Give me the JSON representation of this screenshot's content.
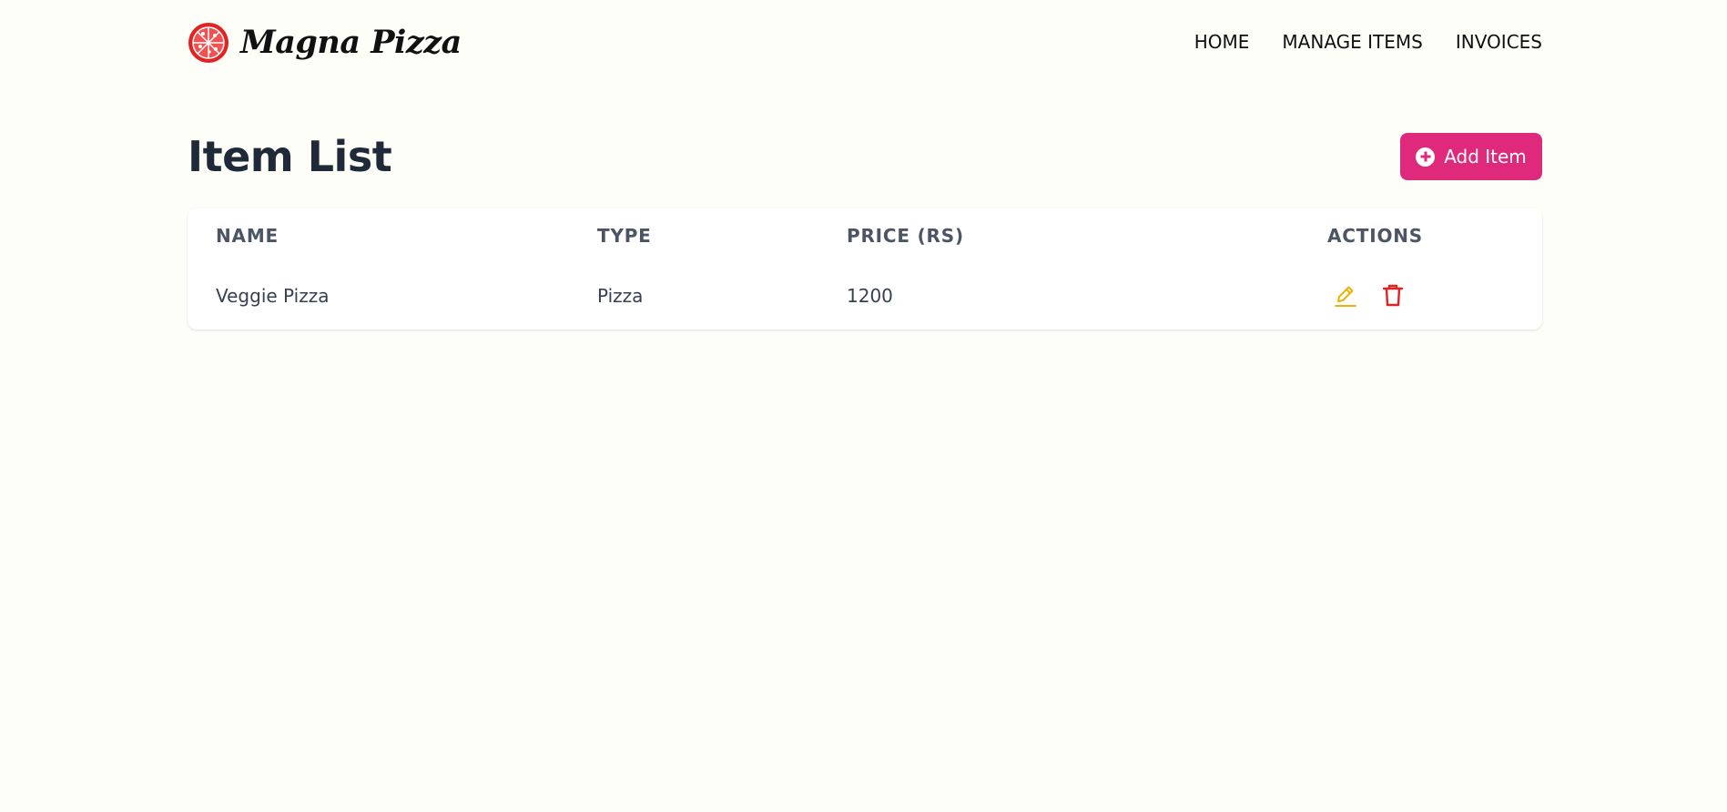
{
  "brand": {
    "name": "Magna Pizza",
    "logo_icon": "pizza-icon",
    "color": "#e02424"
  },
  "nav": {
    "items": [
      {
        "label": "HOME"
      },
      {
        "label": "MANAGE ITEMS"
      },
      {
        "label": "INVOICES"
      }
    ]
  },
  "page": {
    "title": "Item List",
    "add_button": {
      "label": "Add Item",
      "icon": "plus-circle-icon",
      "color": "#df2a7b"
    }
  },
  "table": {
    "headers": [
      "NAME",
      "TYPE",
      "PRICE (RS)",
      "ACTIONS"
    ],
    "rows": [
      {
        "name": "Veggie Pizza",
        "type": "Pizza",
        "price": "1200",
        "actions": [
          "edit-icon",
          "delete-icon"
        ]
      }
    ]
  },
  "colors": {
    "edit_icon": "#eab308",
    "delete_icon": "#e02424",
    "background": "#fefef9"
  }
}
